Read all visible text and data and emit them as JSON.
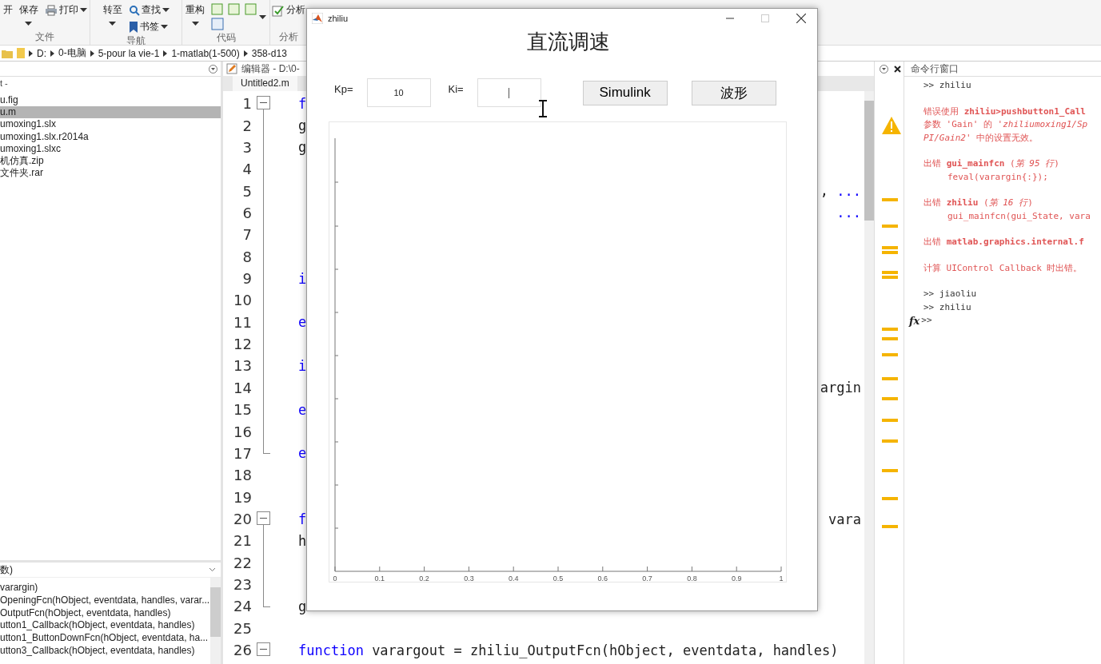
{
  "ribbon": {
    "groups": [
      {
        "label": "文件",
        "buttons": [
          {
            "text": "开",
            "kind": "large",
            "caret": false
          },
          {
            "text": "保存",
            "kind": "large",
            "caret": true
          },
          {
            "text": "打印",
            "kind": "printer",
            "caret": true
          }
        ]
      },
      {
        "label": "导航",
        "buttons": [
          {
            "text": "转至",
            "kind": "large",
            "caret": true
          },
          {
            "text": "查找",
            "kind": "search",
            "caret": true
          },
          {
            "text": "书签",
            "kind": "bookmark",
            "caret": true
          }
        ]
      },
      {
        "label": "代码",
        "buttons": [
          {
            "text": "重构",
            "kind": "large",
            "caret": true
          },
          {
            "kind": "code-tools",
            "caret": true
          }
        ]
      },
      {
        "label": "分析",
        "buttons": [
          {
            "text": "分析",
            "kind": "analyze",
            "caret": false
          }
        ]
      }
    ]
  },
  "path": [
    "D:",
    "0-电脑",
    "5-pour la vie-1",
    "1-matlab(1-500)",
    "358-d13"
  ],
  "files_panel": {
    "title": "t -",
    "files": [
      {
        "name": "u.fig",
        "selected": false
      },
      {
        "name": "u.m",
        "selected": true
      },
      {
        "name": "umoxing1.slx",
        "selected": false
      },
      {
        "name": "umoxing1.slx.r2014a",
        "selected": false
      },
      {
        "name": "umoxing1.slxc",
        "selected": false
      },
      {
        "name": "机仿真.zip",
        "selected": false
      },
      {
        "name": "文件夹.rar",
        "selected": false
      }
    ]
  },
  "functions_panel": {
    "title": "数)",
    "items": [
      "varargin)",
      "OpeningFcn(hObject, eventdata, handles, varar...",
      "OutputFcn(hObject, eventdata, handles)",
      "utton1_Callback(hObject, eventdata, handles)",
      "utton1_ButtonDownFcn(hObject, eventdata, ha...",
      "utton3_Callback(hObject, eventdata, handles)"
    ]
  },
  "editor": {
    "title": "编辑器 - D:\\0-",
    "tab": "Untitled2.m",
    "lines": [
      {
        "number": "1",
        "kind": "fold-start",
        "left": [
          {
            "text": "f",
            "kind": "keyword"
          }
        ]
      },
      {
        "number": "2",
        "kind": "fold-inside",
        "left": [
          {
            "text": "g",
            "kind": "plain"
          }
        ]
      },
      {
        "number": "3",
        "kind": "fold-inside",
        "left": [
          {
            "text": "g",
            "kind": "plain"
          }
        ]
      },
      {
        "number": "4",
        "kind": "fold-inside"
      },
      {
        "number": "5",
        "kind": "fold-inside",
        "right": [
          {
            "text": ", ",
            "kind": "plain"
          },
          {
            "text": "...",
            "kind": "keyword"
          }
        ]
      },
      {
        "number": "6",
        "kind": "fold-inside",
        "right": [
          {
            "text": "...",
            "kind": "keyword"
          }
        ]
      },
      {
        "number": "7",
        "kind": "fold-inside"
      },
      {
        "number": "8",
        "kind": "fold-inside"
      },
      {
        "number": "9",
        "kind": "fold-inside",
        "left": [
          {
            "text": "i",
            "kind": "keyword"
          }
        ]
      },
      {
        "number": "10",
        "kind": "fold-inside"
      },
      {
        "number": "11",
        "kind": "fold-inside",
        "left": [
          {
            "text": "e",
            "kind": "keyword"
          }
        ]
      },
      {
        "number": "12",
        "kind": "fold-inside"
      },
      {
        "number": "13",
        "kind": "fold-inside",
        "left": [
          {
            "text": "i",
            "kind": "keyword"
          }
        ]
      },
      {
        "number": "14",
        "kind": "fold-inside",
        "right": [
          {
            "text": "argin",
            "kind": "plain"
          }
        ]
      },
      {
        "number": "15",
        "kind": "fold-inside",
        "left": [
          {
            "text": "e",
            "kind": "keyword"
          }
        ]
      },
      {
        "number": "16",
        "kind": "fold-inside"
      },
      {
        "number": "17",
        "kind": "fold-end",
        "left": [
          {
            "text": "e",
            "kind": "keyword"
          }
        ]
      },
      {
        "number": "18",
        "kind": "plain"
      },
      {
        "number": "19",
        "kind": "plain"
      },
      {
        "number": "20",
        "kind": "fold-start",
        "left": [
          {
            "text": "f",
            "kind": "keyword"
          }
        ],
        "right": [
          {
            "text": "vara",
            "kind": "plain"
          }
        ]
      },
      {
        "number": "21",
        "kind": "fold-inside",
        "left": [
          {
            "text": "h",
            "kind": "plain"
          }
        ]
      },
      {
        "number": "22",
        "kind": "fold-inside"
      },
      {
        "number": "23",
        "kind": "fold-inside"
      },
      {
        "number": "24",
        "kind": "fold-end",
        "left": [
          {
            "text": "g",
            "kind": "plain"
          }
        ]
      },
      {
        "number": "25",
        "kind": "plain"
      },
      {
        "number": "26",
        "kind": "fold-start",
        "left": [
          {
            "text": "function",
            "kind": "keyword"
          },
          {
            "text": " varargout = zhiliu_OutputFcn(hObject, eventdata, handles)",
            "kind": "plain"
          }
        ]
      }
    ]
  },
  "command_window": {
    "title": "命令行窗口",
    "groups": [
      [
        {
          "text": ">> zhiliu",
          "kind": "prompt"
        }
      ],
      [
        {
          "text": "错误使用 **zhiliu>pushbutton1_Call**",
          "kind": "error"
        },
        {
          "text": "参数 'Gain' 的 '*zhiliumoxing1/Sp*",
          "kind": "error"
        },
        {
          "text": "*PI/Gain2*' 中的设置无效。",
          "kind": "error"
        }
      ],
      [
        {
          "text": "出错 **gui_mainfcn** (*第 95 行*)",
          "kind": "error"
        },
        {
          "text": "feval(varargin{:});",
          "kind": "error-code"
        }
      ],
      [
        {
          "text": "出错 **zhiliu** (*第 16 行*)",
          "kind": "error"
        },
        {
          "text": "gui_mainfcn(gui_State, vara",
          "kind": "error-code"
        }
      ],
      [
        {
          "text": "出错 **matlab.graphics.internal.f**",
          "kind": "error"
        }
      ],
      [
        {
          "text": "计算 UIControl Callback 时出错。",
          "kind": "error"
        }
      ],
      [
        {
          "text": ">> jiaoliu",
          "kind": "prompt"
        },
        {
          "text": ">> zhiliu",
          "kind": "prompt"
        }
      ]
    ],
    "input_icon": "fx",
    "input_prompt": ">>"
  },
  "figure_window": {
    "title": "zhiliu",
    "heading": "直流调速",
    "fields": [
      {
        "label": "Kp=",
        "value": "10",
        "focused": false
      },
      {
        "label": "Ki=",
        "focused": true
      }
    ],
    "buttons": [
      "Simulink",
      "波形"
    ],
    "x_tick_labels": [
      "0",
      "0.1",
      "0.2",
      "0.3",
      "0.4",
      "0.5",
      "0.6",
      "0.7",
      "0.8",
      "0.9",
      "1"
    ]
  }
}
